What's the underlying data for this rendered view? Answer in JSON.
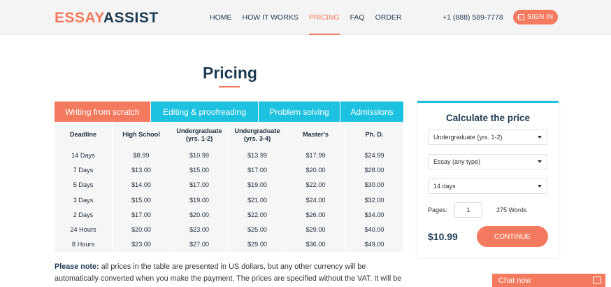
{
  "header": {
    "logo_part1": "ESSAY",
    "logo_part2": "ASSIST",
    "nav": [
      {
        "label": "HOME"
      },
      {
        "label": "HOW IT WORKS"
      },
      {
        "label": "PRICING"
      },
      {
        "label": "FAQ"
      },
      {
        "label": "ORDER"
      }
    ],
    "active_nav": "PRICING",
    "phone": "+1 (888) 589-7778",
    "signin_label": "SIGN IN"
  },
  "page_title": "Pricing",
  "tabs": [
    {
      "label": "Writing from scratch"
    },
    {
      "label": "Editing & proofreading"
    },
    {
      "label": "Problem solving"
    },
    {
      "label": "Admissions"
    }
  ],
  "active_tab": "Writing from scratch",
  "price_table": {
    "headers": [
      [
        "Deadline"
      ],
      [
        "High School"
      ],
      [
        "Undergraduate",
        "(yrs. 1-2)"
      ],
      [
        "Undergraduate",
        "(yrs. 3-4)"
      ],
      [
        "Master's"
      ],
      [
        "Ph. D."
      ]
    ],
    "rows": [
      [
        "14 Days",
        "$8.99",
        "$10.99",
        "$13.99",
        "$17.99",
        "$24.99"
      ],
      [
        "7 Days",
        "$13.00",
        "$15.00",
        "$17.00",
        "$20.00",
        "$28.00"
      ],
      [
        "5 Days",
        "$14.00",
        "$17.00",
        "$19.00",
        "$22.00",
        "$30.00"
      ],
      [
        "3 Days",
        "$15.00",
        "$19.00",
        "$21.00",
        "$24.00",
        "$32.00"
      ],
      [
        "2 Days",
        "$17.00",
        "$20.00",
        "$22.00",
        "$26.00",
        "$34.00"
      ],
      [
        "24 Hours",
        "$20.00",
        "$23.00",
        "$25.00",
        "$29.00",
        "$40.00"
      ],
      [
        "8 Hours",
        "$23.00",
        "$27.00",
        "$29.00",
        "$36.00",
        "$49.00"
      ]
    ]
  },
  "note": {
    "label": "Please note:",
    "text": " all prices in the table are presented in US dollars, but any other currency will be automatically converted when you make the payment. The prices are specified without the VAT. It will be charged"
  },
  "calculator": {
    "title": "Calculate the price",
    "academic_level": "Undergraduate (yrs. 1-2)",
    "paper_type": "Essay (any type)",
    "deadline": "14 days",
    "pages_label": "Pages:",
    "pages_value": "1",
    "words": "275 Words",
    "price": "$10.99",
    "continue_label": "CONTINUE"
  },
  "chat": {
    "label": "Chat now"
  },
  "colors": {
    "accent": "#f47a5f",
    "tab_blue": "#1ec2e1",
    "navy": "#1d3b53"
  }
}
